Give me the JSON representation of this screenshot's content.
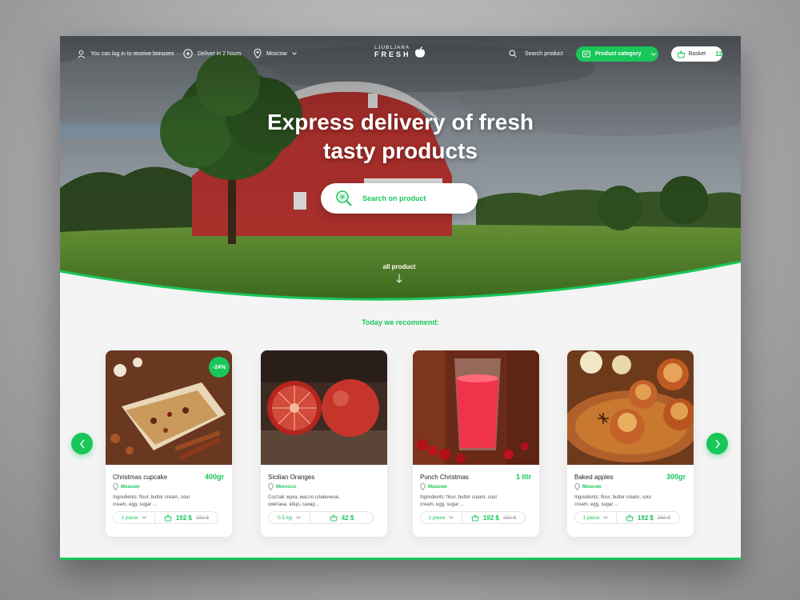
{
  "topbar": {
    "login_text": "You can log in to receive bonuses",
    "delivery_text": "Deliver in 2 hours",
    "city": "Moscow",
    "logo_line1": "LJUBLJANA",
    "logo_line2": "FRESH",
    "search_label": "Search product",
    "category_button": "Product category",
    "basket_label": "Basket",
    "basket_count": "12"
  },
  "hero": {
    "title_line1": "Express delivery of fresh",
    "title_line2": "tasty products",
    "search_button": "Search on product",
    "all_product": "all product"
  },
  "section": {
    "recommend_title": "Today we recommend:"
  },
  "products": [
    {
      "name": "Christmas cupcake",
      "quantity": "400gr",
      "location": "Moscow",
      "ingredients": "Ingredients: flour, butter cream, sour cream, egg, sugar ...",
      "amount": "1 piece",
      "price": "192 $",
      "old_price": "250 $",
      "badge": "-24%"
    },
    {
      "name": "Sicilian Oranges",
      "quantity": "",
      "location": "Morocco",
      "ingredients": "Состав: мука, масло сливочное, сметана, яйцо, сахар...",
      "amount": "0.5 kg",
      "price": "42 $",
      "old_price": ""
    },
    {
      "name": "Punch Christmas",
      "quantity": "1 litr",
      "location": "Moscow",
      "ingredients": "Ingredients: flour, butter cream, sour cream, egg, sugar ...",
      "amount": "1 piece",
      "price": "192 $",
      "old_price": "250 $"
    },
    {
      "name": "Baked apples",
      "quantity": "300gr",
      "location": "Moscow",
      "ingredients": "Ingredients: flour, butter cream, sour cream, egg, sugar ...",
      "amount": "1 piece",
      "price": "192 $",
      "old_price": "250 $"
    }
  ],
  "colors": {
    "accent": "#19c65a",
    "barn": "#b8332f",
    "text": "#222222"
  }
}
